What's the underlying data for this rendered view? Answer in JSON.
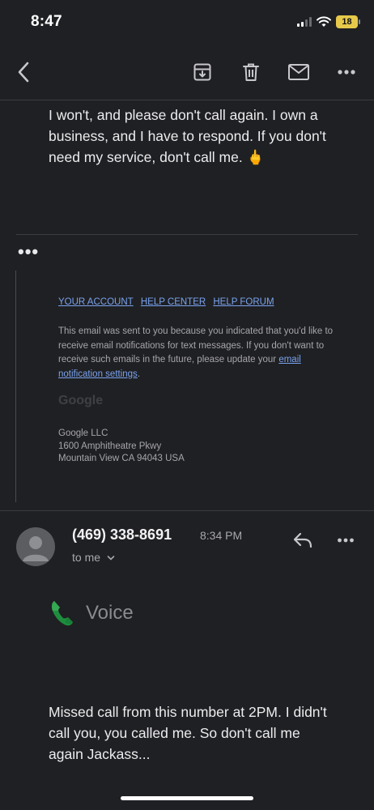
{
  "status_bar": {
    "time": "8:47",
    "battery": "18"
  },
  "toolbar": {
    "back_icon": "chevron-left-icon",
    "archive_icon": "archive-icon",
    "delete_icon": "trash-icon",
    "mark_unread_icon": "mail-icon",
    "more_icon": "more-horizontal-icon"
  },
  "previous_message": {
    "text": "I won't, and please don't call again. I own a business, and I have to respond. If you don't need my service, don't call me. 🖕"
  },
  "quoted": {
    "dots": "•••",
    "links": [
      "YOUR ACCOUNT",
      "HELP CENTER",
      "HELP FORUM"
    ],
    "note_before_link": "This email was sent to you because you indicated that you'd like to receive email notifications for text messages. If you don't want to receive such emails in the future, please update your ",
    "note_link": "email notification settings",
    "note_after_link": ".",
    "logo": "Google",
    "address_lines": [
      "Google LLC",
      "1600 Amphitheatre Pkwy",
      "Mountain View CA 94043 USA"
    ]
  },
  "message": {
    "sender": "(469) 338-8691",
    "time": "8:34 PM",
    "recipient": "to me",
    "brand": "Voice",
    "body": "Missed call from this number at 2PM. I didn't call you, you called me. So don't call me again Jackass..."
  },
  "colors": {
    "background": "#1f2023",
    "link": "#7aa3ef",
    "voice_green": "#1e8e3e"
  }
}
